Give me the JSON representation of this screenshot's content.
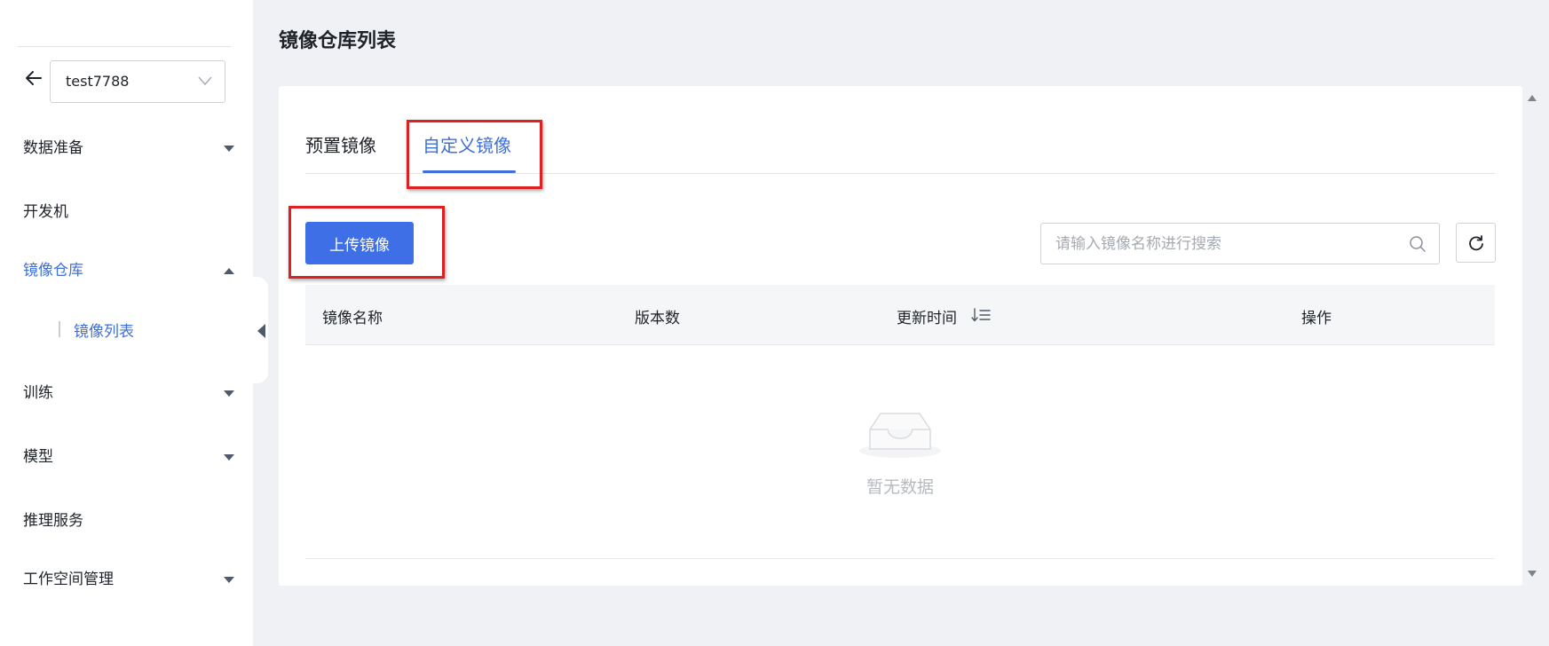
{
  "sidebar": {
    "project_select": {
      "value": "test7788"
    },
    "items": [
      {
        "label": "数据准备",
        "expanded": false
      },
      {
        "label": "开发机"
      },
      {
        "label": "镜像仓库",
        "expanded": true,
        "active": true
      },
      {
        "label": "训练",
        "expanded": false
      },
      {
        "label": "模型",
        "expanded": false
      },
      {
        "label": "推理服务"
      },
      {
        "label": "工作空间管理",
        "expanded": false
      }
    ],
    "sub_item": {
      "label": "镜像列表",
      "active": true
    }
  },
  "page": {
    "title": "镜像仓库列表"
  },
  "tabs": [
    {
      "label": "预置镜像",
      "active": false
    },
    {
      "label": "自定义镜像",
      "active": true
    }
  ],
  "toolbar": {
    "upload_label": "上传镜像",
    "search_placeholder": "请输入镜像名称进行搜索",
    "search_value": ""
  },
  "table": {
    "columns": [
      "镜像名称",
      "版本数",
      "更新时间",
      "操作"
    ],
    "rows": [],
    "empty_text": "暂无数据"
  },
  "colors": {
    "accent": "#3f6fd8",
    "primary_button": "#3f6fe6",
    "highlight_box": "#e02020",
    "background": "#f0f1f4"
  },
  "icons": [
    "arrow-left-icon",
    "chevron-down-icon",
    "caret-down-icon",
    "caret-up-icon",
    "collapse-left-icon",
    "search-icon",
    "refresh-icon",
    "sort-icon",
    "empty-inbox-icon"
  ]
}
